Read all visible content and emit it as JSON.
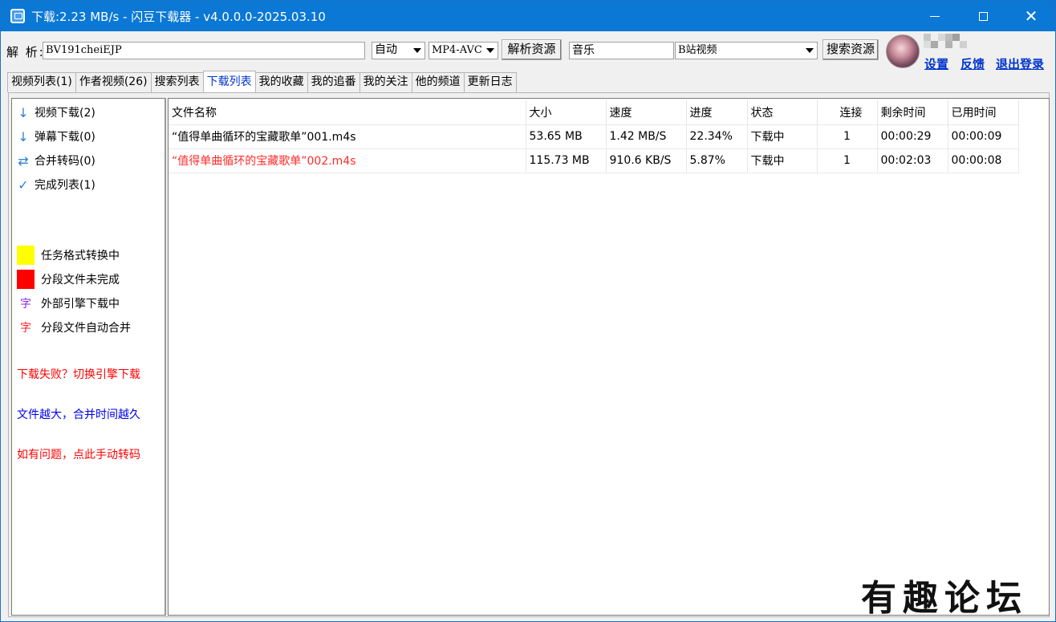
{
  "window": {
    "title": "下载:2.23 MB/s - 闪豆下载器 - v4.0.0.0-2025.03.10",
    "controls": {
      "minimize": "minimize",
      "maximize": "maximize",
      "close": "✕"
    }
  },
  "toolbar": {
    "parse_label": "解 析:",
    "url_value": "BV191cheiEJP",
    "quality_select": "自动",
    "format_select": "MP4-AVC",
    "parse_button": "解析资源",
    "search_input": "音乐",
    "search_source_select": "B站视频",
    "search_button": "搜索资源",
    "links": {
      "settings": "设置",
      "feedback": "反馈",
      "logout": "退出登录"
    }
  },
  "tabs": [
    {
      "label": "视频列表(1)",
      "active": false
    },
    {
      "label": "作者视频(26)",
      "active": false
    },
    {
      "label": "搜索列表",
      "active": false
    },
    {
      "label": "下载列表",
      "active": true
    },
    {
      "label": "我的收藏",
      "active": false
    },
    {
      "label": "我的追番",
      "active": false
    },
    {
      "label": "我的关注",
      "active": false
    },
    {
      "label": "他的频道",
      "active": false
    },
    {
      "label": "更新日志",
      "active": false
    }
  ],
  "sidebar": {
    "items": [
      {
        "icon": "arrow-down-icon",
        "glyph": "↓",
        "label": "视频下载(2)"
      },
      {
        "icon": "arrow-down-icon",
        "glyph": "↓",
        "label": "弹幕下载(0)"
      },
      {
        "icon": "convert-arrows-icon",
        "glyph": "⇄",
        "label": "合并转码(0)"
      },
      {
        "icon": "check-icon",
        "glyph": "✓",
        "label": "完成列表(1)"
      }
    ],
    "legend": [
      {
        "color": "#ffff00",
        "label": "任务格式转换中"
      },
      {
        "color": "#ff0000",
        "label": "分段文件未完成"
      },
      {
        "glyph": "字",
        "glyph_color": "#8a2be2",
        "label": "外部引擎下载中"
      },
      {
        "glyph": "字",
        "glyph_color": "#ff2020",
        "label": "分段文件自动合并"
      }
    ],
    "notes": [
      {
        "text": "下载失败？切换引擎下载",
        "color": "#ff0000"
      },
      {
        "text": "文件越大，合并时间越久",
        "color": "#0000ee"
      },
      {
        "text": "如有问题，点此手动转码",
        "color": "#ff0000"
      }
    ]
  },
  "download_table": {
    "columns": [
      "文件名称",
      "大小",
      "速度",
      "进度",
      "状态",
      "连接",
      "剩余时间",
      "已用时间"
    ],
    "rows": [
      {
        "name": "“值得单曲循环的宝藏歌单”001.m4s",
        "size": "53.65 MB",
        "speed": "1.42 MB/S",
        "progress": "22.34%",
        "status": "下载中",
        "connections": "1",
        "remaining": "00:00:29",
        "elapsed": "00:00:09",
        "highlight": false
      },
      {
        "name": "“值得单曲循环的宝藏歌单”002.m4s",
        "size": "115.73 MB",
        "speed": "910.6 KB/S",
        "progress": "5.87%",
        "status": "下载中",
        "connections": "1",
        "remaining": "00:02:03",
        "elapsed": "00:00:08",
        "highlight": true
      }
    ]
  },
  "watermark": "有趣论坛"
}
